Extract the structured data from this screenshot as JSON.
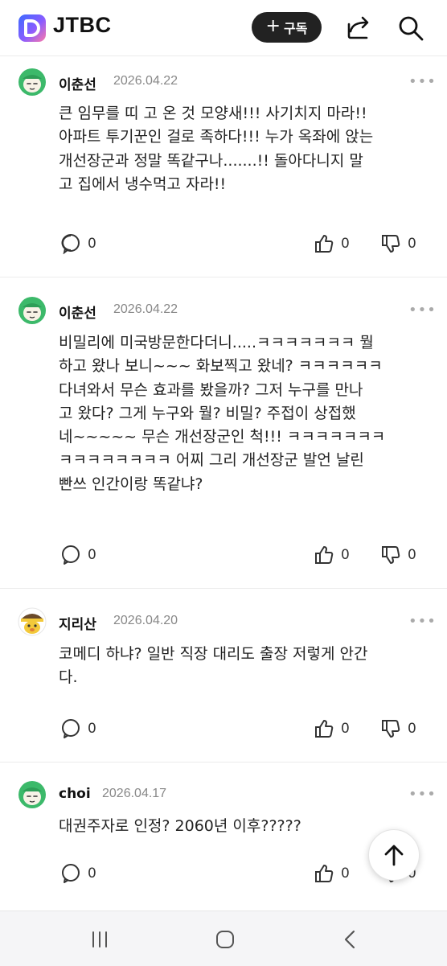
{
  "header": {
    "brand": "JTBC",
    "subscribe_label": "구독",
    "icons": [
      "jtbc-logo-icon",
      "share-icon",
      "search-icon"
    ]
  },
  "comments": [
    {
      "author": "이춘선",
      "date": "2026.04.22",
      "avatar": "green-character-avatar",
      "text": "큰 임무를 띠 고 온 것 모양새!!! 사기치지 마라!!\n아파트 투기꾼인 걸로 족하다!!! 누가 옥좌에 앉는\n개선장군과 정말 똑같구나.......!! 돌아다니지 말\n고 집에서 냉수먹고 자라!!",
      "replies": "0",
      "likes": "0",
      "dislikes": "0"
    },
    {
      "author": "이춘선",
      "date": "2026.04.22",
      "avatar": "green-character-avatar",
      "text": "비밀리에 미국방문한다더니.....ㅋㅋㅋㅋㅋㅋㅋ 뭘\n하고 왔나 보니~~~ 화보찍고 왔네? ㅋㅋㅋㅋㅋㅋ\n다녀와서 무슨 효과를 봤을까? 그저 누구를 만나\n고 왔다? 그게 누구와 뭘? 비밀? 주접이 상접했\n네~~~~~ 무슨 개선장군인 척!!! ㅋㅋㅋㅋㅋㅋㅋ\nㅋㅋㅋㅋㅋㅋㅋㅋ 어찌 그리 개선장군 발언 날린\n빤쓰 인간이랑 똑같냐?",
      "replies": "0",
      "likes": "0",
      "dislikes": "0"
    },
    {
      "author": "지리산",
      "date": "2026.04.20",
      "avatar": "yellow-character-avatar",
      "text": "코메디 하냐? 일반 직장 대리도 출장 저렇게 안간\n다.",
      "replies": "0",
      "likes": "0",
      "dislikes": "0"
    },
    {
      "author": "choi",
      "date": "2026.04.17",
      "avatar": "green-character-avatar",
      "text": "대권주자로 인정? 2060년 이후?????",
      "replies": "0",
      "likes": "0",
      "dislikes": "0"
    }
  ],
  "more_glyph": "•••",
  "floating": {
    "icon": "arrow-up-icon"
  },
  "system_nav": {
    "icons": [
      "recent-apps-icon",
      "home-icon",
      "back-icon"
    ]
  },
  "colors": {
    "subscribe_bg": "#222222",
    "divider": "#ececec",
    "avatar_green": "#3cb96a",
    "avatar_yellow": "#f3c93a"
  }
}
